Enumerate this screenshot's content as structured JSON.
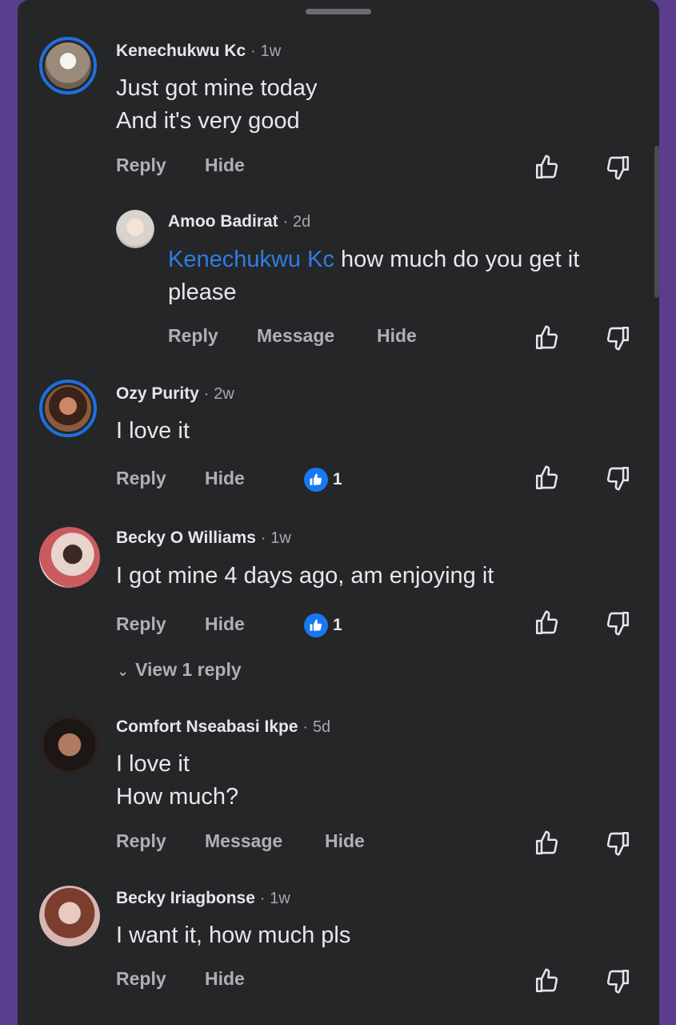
{
  "comments": [
    {
      "author": "Kenechukwu Kc",
      "time": "1w",
      "lines": [
        "Just got mine today",
        "And it's very good"
      ],
      "actions": [
        "Reply",
        "Hide"
      ]
    },
    {
      "author": "Amoo Badirat",
      "time": "2d",
      "mention": "Kenechukwu Kc",
      "text_after_mention": " how much do you get it",
      "line2": "please",
      "actions": [
        "Reply",
        "Message",
        "Hide"
      ]
    },
    {
      "author": "Ozy Purity",
      "time": "2w",
      "lines": [
        "I love it"
      ],
      "actions": [
        "Reply",
        "Hide"
      ],
      "like_count": "1"
    },
    {
      "author": "Becky O Williams",
      "time": "1w",
      "lines": [
        "I got mine 4 days ago, am enjoying it"
      ],
      "actions": [
        "Reply",
        "Hide"
      ],
      "like_count": "1",
      "view_replies": "View 1 reply"
    },
    {
      "author": "Comfort Nseabasi Ikpe",
      "time": "5d",
      "lines": [
        "I love it",
        "How much?"
      ],
      "actions": [
        "Reply",
        "Message",
        "Hide"
      ]
    },
    {
      "author": "Becky Iriagbonse",
      "time": "1w",
      "lines": [
        "I want it, how much pls"
      ],
      "actions": [
        "Reply",
        "Hide"
      ]
    }
  ],
  "time_separator": "·",
  "colors": {
    "background": "#252628",
    "frame": "#5b3d8e",
    "accent": "#1877f2",
    "mention": "#2f7de6"
  }
}
